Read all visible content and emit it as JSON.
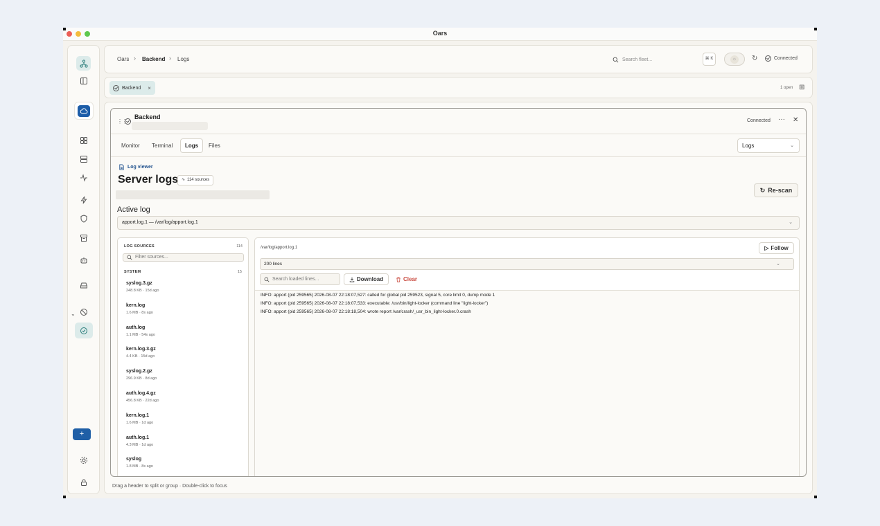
{
  "window": {
    "title": "Oars"
  },
  "breadcrumb": [
    "Oars",
    "Backend",
    "Logs"
  ],
  "topbar": {
    "search_placeholder": "Search fleet...",
    "shortcut": "⌘ K",
    "status": "Connected"
  },
  "tabs": {
    "open_tab_label": "Backend",
    "open_count": "1 open"
  },
  "card": {
    "title": "Backend",
    "status": "Connected",
    "subtabs": [
      "Monitor",
      "Terminal",
      "Logs",
      "Files"
    ],
    "active_subtab": "Logs",
    "view_select": "Logs"
  },
  "logs": {
    "viewer_label": "Log viewer",
    "title": "Server logs",
    "sources_badge": "114 sources",
    "rescan": "Re-scan",
    "active_log_label": "Active log",
    "active_log_value": "apport.log.1 — /var/log/apport.log.1"
  },
  "sources": {
    "header": "LOG SOURCES",
    "count": "114",
    "filter_placeholder": "Filter sources...",
    "group_name": "SYSTEM",
    "group_count": "15",
    "items": [
      {
        "name": "syslog.3.gz",
        "meta": "248.8 KB · 15d ago"
      },
      {
        "name": "kern.log",
        "meta": "1.6 MB · 8s ago"
      },
      {
        "name": "auth.log",
        "meta": "1.1 MB · 54s ago"
      },
      {
        "name": "kern.log.3.gz",
        "meta": "4.4 KB · 15d ago"
      },
      {
        "name": "syslog.2.gz",
        "meta": "296.9 KB · 8d ago"
      },
      {
        "name": "auth.log.4.gz",
        "meta": "456.8 KB · 22d ago"
      },
      {
        "name": "kern.log.1",
        "meta": "1.6 MB · 1d ago"
      },
      {
        "name": "auth.log.1",
        "meta": "4.3 MB · 1d ago"
      },
      {
        "name": "syslog",
        "meta": "1.8 MB · 8s ago"
      }
    ]
  },
  "viewer": {
    "path": "/var/log/apport.log.1",
    "follow": "Follow",
    "lines_option": "200 lines",
    "search_placeholder": "Search loaded lines...",
    "download": "Download",
    "clear": "Clear",
    "lines": [
      "INFO: apport (pid 259565) 2026-08-07 22:18:07,527: called for global pid 259523, signal 5, core limit 0, dump mode 1",
      "INFO: apport (pid 259565) 2026-08-07 22:18:07,533: executable: /usr/bin/light-locker (command line \"light-locker\")",
      "INFO: apport (pid 259565) 2026-08-07 22:18:18,504: wrote report /var/crash/_usr_bin_light-locker.0.crash"
    ]
  },
  "footer": {
    "hint": "Drag a header to split or group · Double-click to focus"
  },
  "colors": {
    "accent": "#1f5fa6",
    "active_bg": "#dcebea",
    "danger": "#c94a3f"
  }
}
